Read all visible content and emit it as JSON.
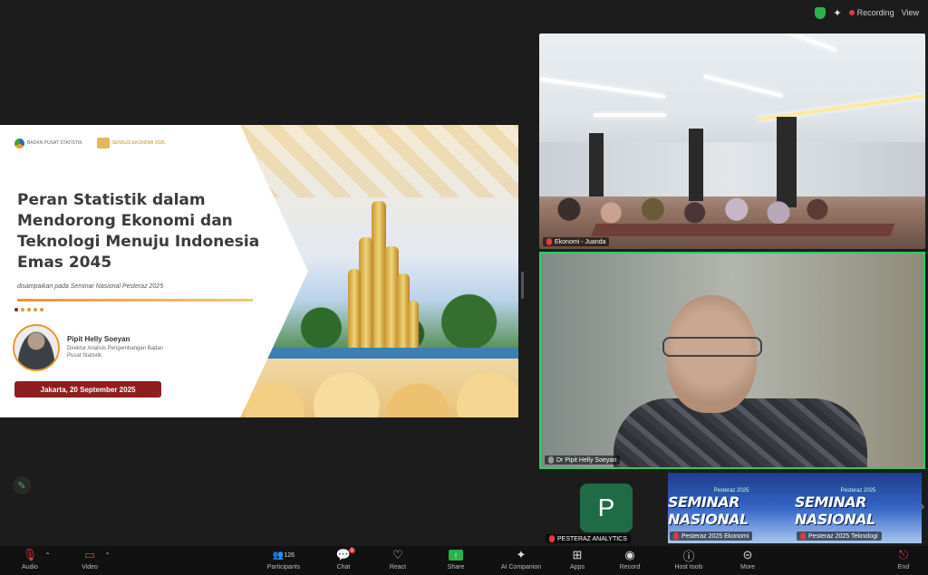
{
  "status": {
    "recording_label": "Recording",
    "view_label": "View"
  },
  "slide": {
    "logo_bps": "BADAN PUSAT STATISTIK",
    "logo_sensus": "SENSUS EKONOMI 2026",
    "title": "Peran Statistik dalam Mendorong Ekonomi dan Teknologi Menuju Indonesia Emas 2045",
    "subtitle": "disampaikan pada Seminar Nasional Pesteraz 2025",
    "speaker_name": "Pipit Helly Soeyan",
    "speaker_role": "Direktur Analisis Pengembangan Badan Pusat Statistik",
    "date": "Jakarta, 20 September 2025"
  },
  "tiles": {
    "room_name": "Ekonomi - Juanda",
    "speaker_name": "Dr Pipit Helly Soeyan",
    "p_initial": "P",
    "p_name": "PESTERAZ ANALYTICS",
    "seminar_small": "Pesteraz 2025",
    "seminar_big": "SEMINAR NASIONAL",
    "seminar_name_1": "Pesteraz 2025 Ekonomi",
    "seminar_name_2": "Pesteraz 2025 Teknologi"
  },
  "toolbar": {
    "audio": "Audio",
    "video": "Video",
    "participants": "Participants",
    "participants_count": "126",
    "chat": "Chat",
    "chat_badge": "1",
    "react": "React",
    "share": "Share",
    "ai_companion": "AI Companion",
    "apps": "Apps",
    "record": "Record",
    "host_tools": "Host tools",
    "more": "More",
    "end": "End"
  },
  "icons": [
    "shield-icon",
    "sparkle-icon",
    "mic-muted-icon",
    "video-off-icon",
    "participants-icon",
    "chat-icon",
    "heart-icon",
    "share-screen-icon",
    "sparkle-icon",
    "apps-icon",
    "record-icon",
    "host-tools-icon",
    "more-icon",
    "leave-icon",
    "pencil-icon"
  ],
  "colors": {
    "active_speaker_border": "#2bd05a",
    "recording_dot": "#e23b3b",
    "share_green": "#27b34a",
    "avatar_bg": "#1f6b46",
    "date_badge": "#8e1f1f"
  }
}
